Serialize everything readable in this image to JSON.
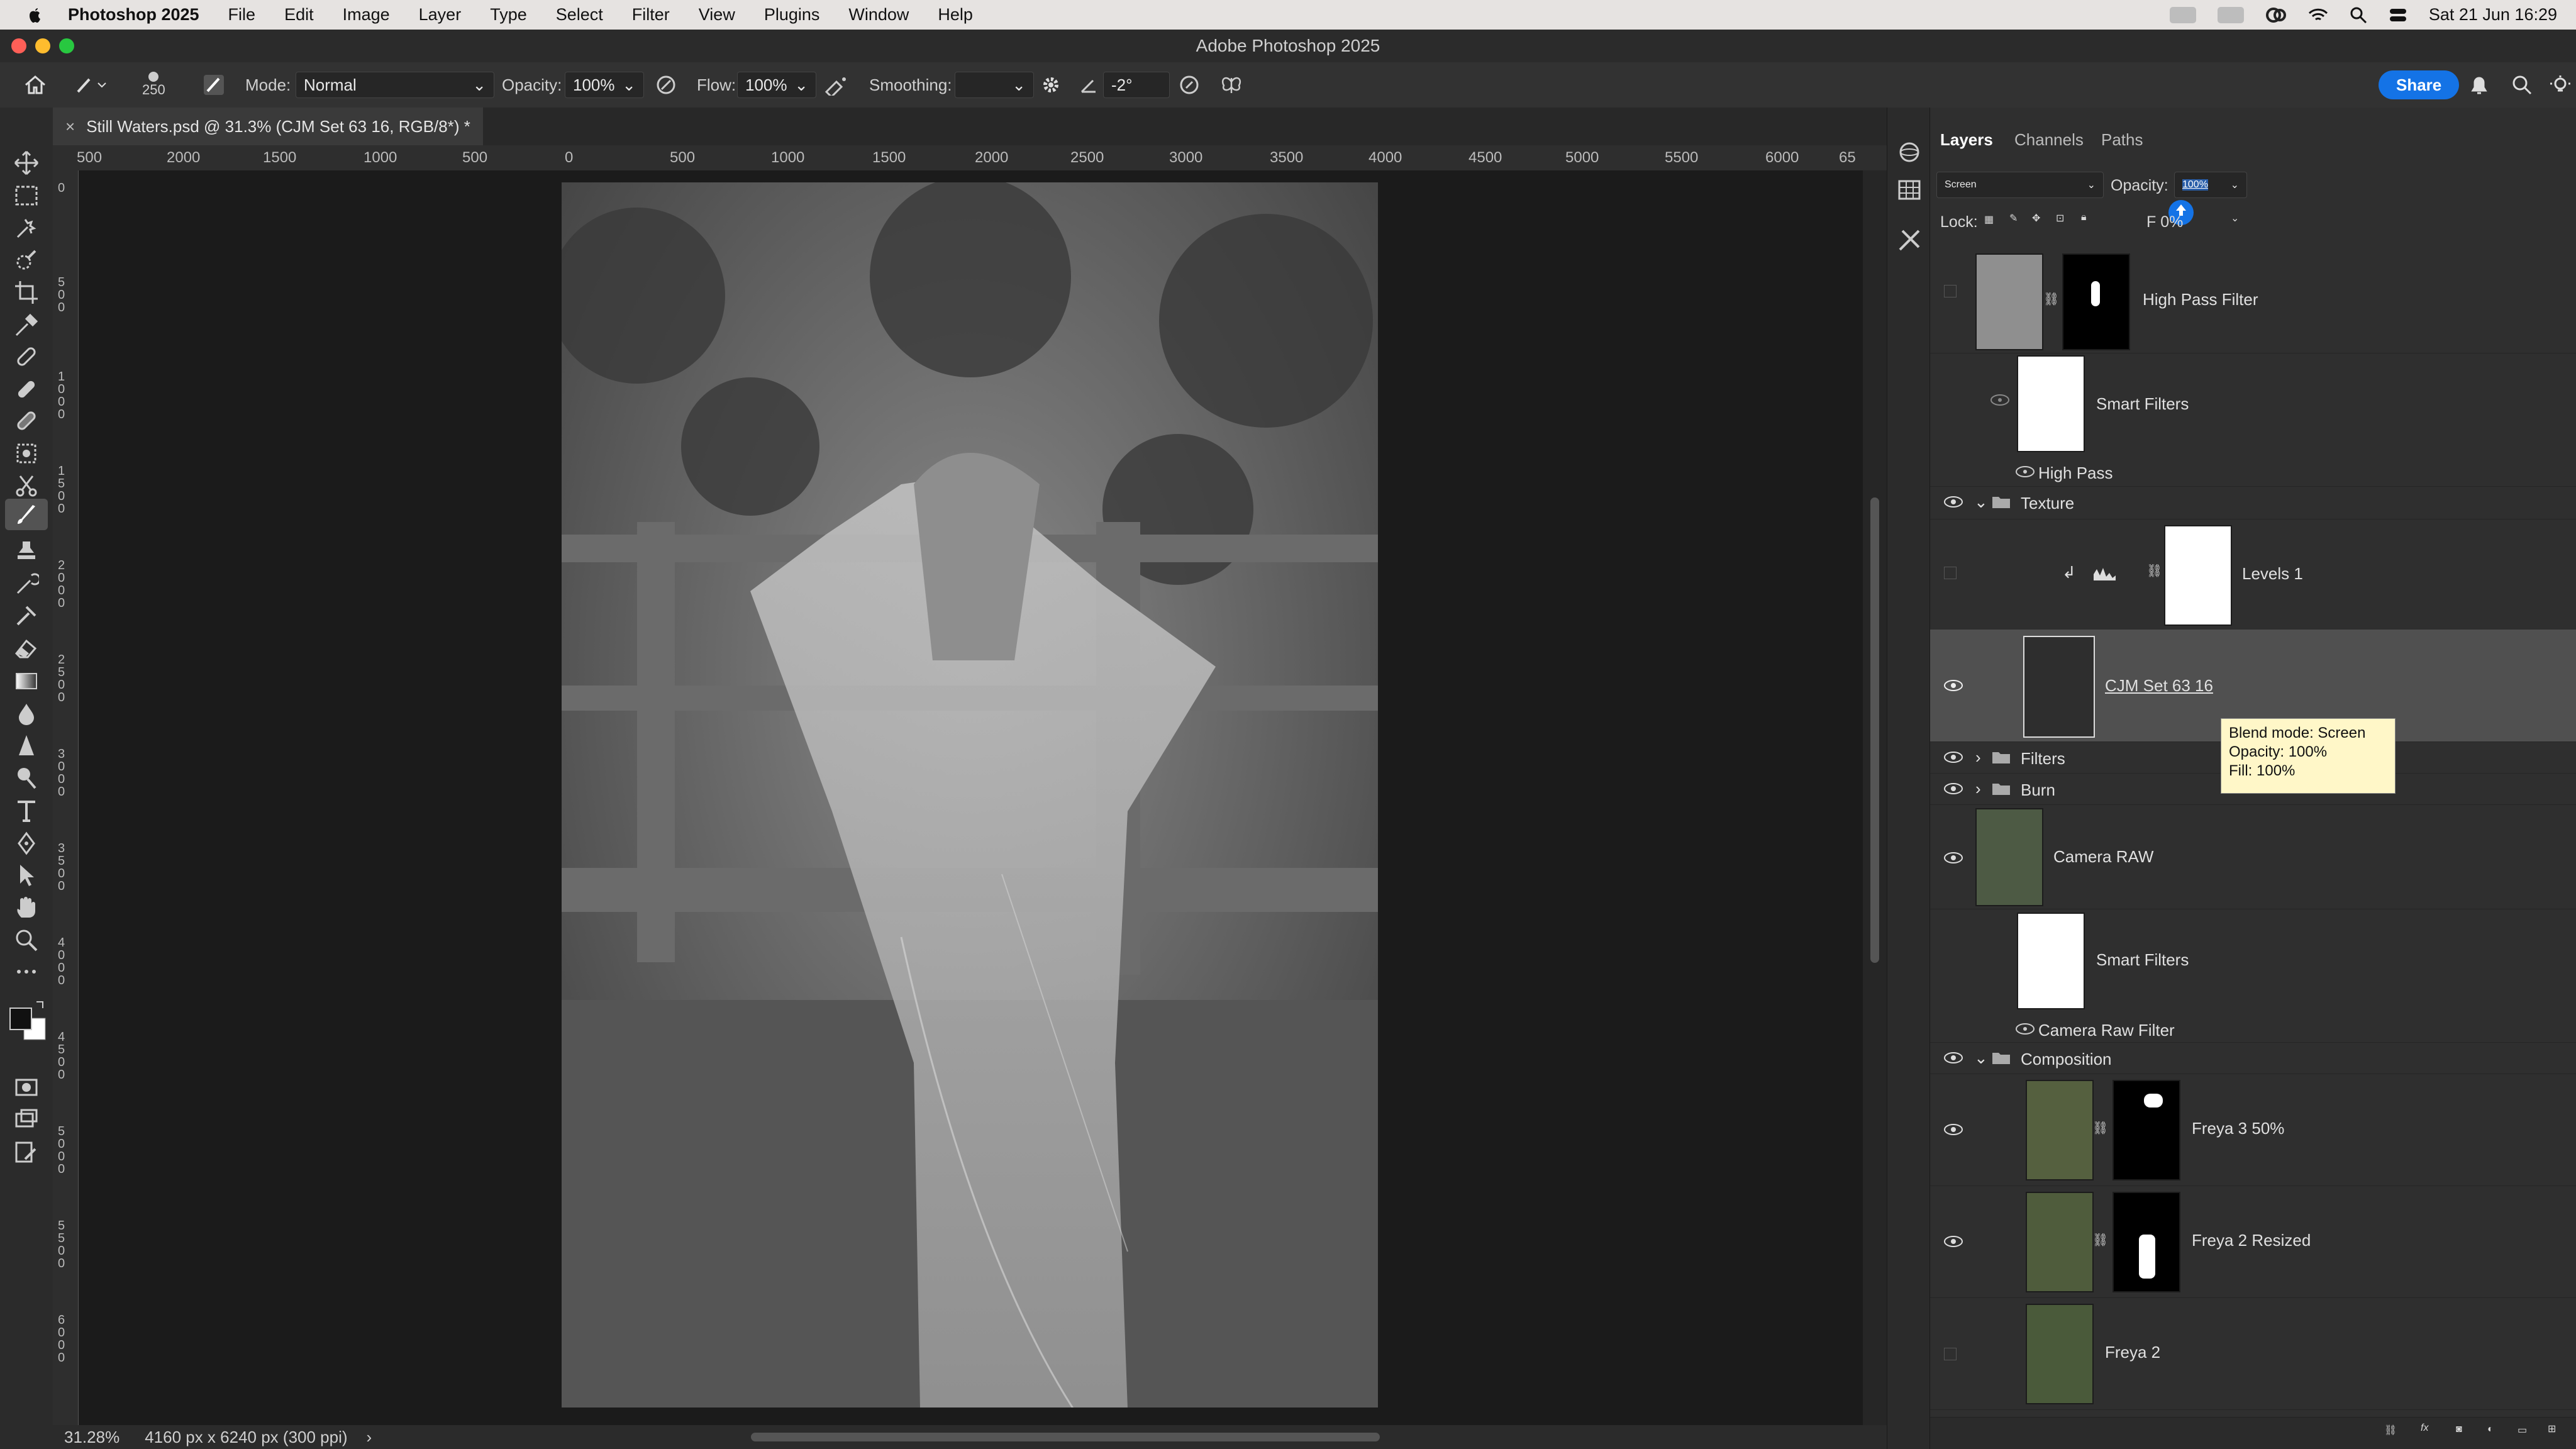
{
  "menubar": {
    "app_name": "Photoshop 2025",
    "items": [
      "File",
      "Edit",
      "Image",
      "Layer",
      "Type",
      "Select",
      "Filter",
      "View",
      "Plugins",
      "Window",
      "Help"
    ],
    "clock": "Sat 21 Jun  16:29"
  },
  "window": {
    "title": "Adobe Photoshop 2025"
  },
  "options": {
    "brush_size": "250",
    "mode_label": "Mode:",
    "mode_value": "Normal",
    "opacity_label": "Opacity:",
    "opacity_value": "100%",
    "flow_label": "Flow:",
    "flow_value": "100%",
    "smoothing_label": "Smoothing:",
    "smoothing_value": "",
    "angle_value": "-2°",
    "share_label": "Share"
  },
  "document": {
    "tab_title": "Still Waters.psd @ 31.3% (CJM Set 63 16, RGB/8*) *",
    "zoom": "31.28%",
    "doc_info": "4160 px x 6240 px (300 ppi)"
  },
  "rulers": {
    "h_labels": [
      "500",
      "2000",
      "1500",
      "1000",
      "500",
      "0",
      "500",
      "1000",
      "1500",
      "2000",
      "2500",
      "3000",
      "3500",
      "4000",
      "4500",
      "5000",
      "5500",
      "6000",
      "65"
    ],
    "v_labels": [
      "0",
      "500",
      "1000",
      "1500",
      "2000",
      "2500",
      "3000",
      "3500",
      "4000",
      "4500",
      "5000",
      "5500",
      "6000"
    ]
  },
  "layers_panel": {
    "tabs": [
      "Layers",
      "Channels",
      "Paths"
    ],
    "blend_mode": "Screen",
    "opacity_label": "Opacity:",
    "opacity_value": "100%",
    "lock_label": "Lock:",
    "fill_label": "Fill:",
    "fill_value": "100%",
    "fill_obscured_text": "F    0%",
    "layers": {
      "high_pass_filter": "High Pass Filter",
      "smart_filters_1": "Smart Filters",
      "high_pass": "High Pass",
      "texture": "Texture",
      "levels_1": "Levels 1",
      "cjm_set": "CJM Set 63 16",
      "filters": "Filters",
      "burn": "Burn",
      "camera_raw": "Camera RAW",
      "smart_filters_2": "Smart Filters",
      "camera_raw_filter": "Camera Raw Filter",
      "composition": "Composition",
      "freya3": "Freya 3 50%",
      "freya2_resized": "Freya 2 Resized",
      "freya2": "Freya 2"
    },
    "tooltip": {
      "line1": "Blend mode: Screen",
      "line2": "Opacity: 100%",
      "line3": "Fill: 100%"
    }
  },
  "colors": {
    "accent": "#1473e6",
    "panel_bg": "#2f2f2f",
    "selected_layer": "#505050",
    "tooltip_bg": "#fff7c8"
  }
}
